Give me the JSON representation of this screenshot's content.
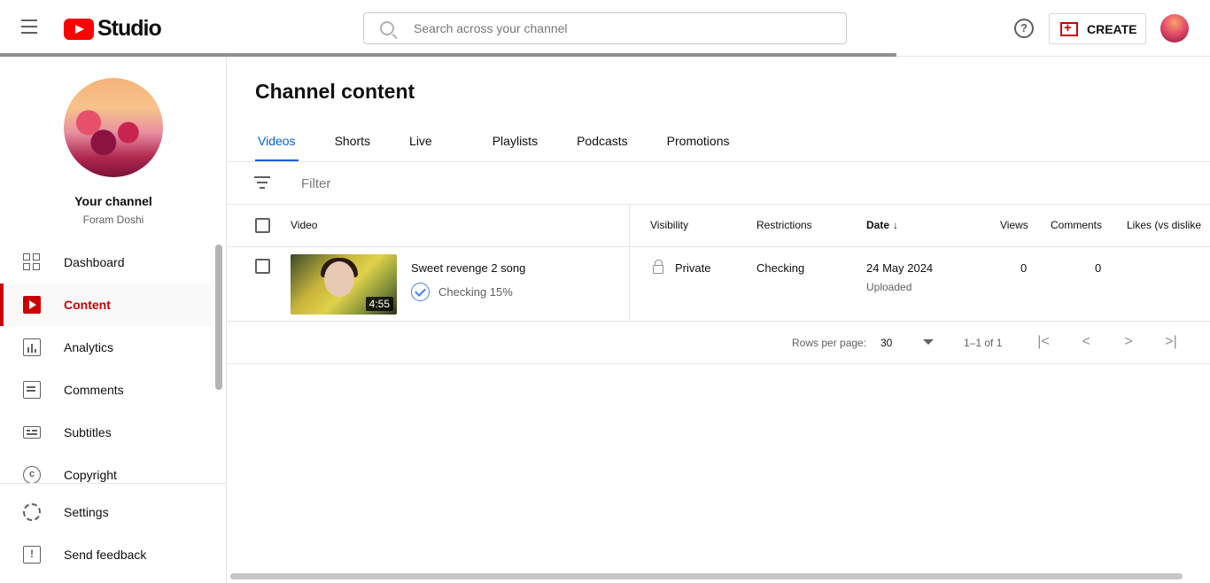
{
  "header": {
    "logo_text": "Studio",
    "search_placeholder": "Search across your channel",
    "help_glyph": "?",
    "create_label": "CREATE"
  },
  "sidebar": {
    "your_channel": "Your channel",
    "channel_name": "Foram Doshi",
    "items": [
      {
        "label": "Dashboard",
        "icon": "dashboard-icon"
      },
      {
        "label": "Content",
        "icon": "content-icon",
        "active": true
      },
      {
        "label": "Analytics",
        "icon": "analytics-icon"
      },
      {
        "label": "Comments",
        "icon": "comments-icon"
      },
      {
        "label": "Subtitles",
        "icon": "subtitles-icon"
      },
      {
        "label": "Copyright",
        "icon": "copyright-icon"
      }
    ],
    "bottom_items": [
      {
        "label": "Settings",
        "icon": "gear-icon"
      },
      {
        "label": "Send feedback",
        "icon": "feedback-icon"
      }
    ],
    "copyright_glyph": "c",
    "feedback_glyph": "!"
  },
  "main": {
    "title": "Channel content",
    "tabs": [
      {
        "label": "Videos",
        "active": true
      },
      {
        "label": "Shorts"
      },
      {
        "label": "Live"
      },
      {
        "label": "Playlists"
      },
      {
        "label": "Podcasts"
      },
      {
        "label": "Promotions"
      }
    ],
    "filter_placeholder": "Filter",
    "columns": {
      "video": "Video",
      "visibility": "Visibility",
      "restrictions": "Restrictions",
      "date": "Date",
      "views": "Views",
      "comments": "Comments",
      "likes": "Likes (vs dislike"
    },
    "sort_arrow": "↓",
    "rows": [
      {
        "title": "Sweet revenge 2 song",
        "duration": "4:55",
        "status": "Checking 15%",
        "visibility": "Private",
        "restrictions": "Checking",
        "date": "24 May 2024",
        "date_sub": "Uploaded",
        "views": "0",
        "comments": "0"
      }
    ],
    "pager": {
      "rows_per_page_label": "Rows per page:",
      "rows_per_page_value": "30",
      "range": "1–1 of 1",
      "first": "|<",
      "prev": "<",
      "next": ">",
      "last": ">|"
    }
  },
  "colors": {
    "brand_red": "#cc0000",
    "active_tab": "#065fd4",
    "youtube_red": "#ff0000"
  }
}
